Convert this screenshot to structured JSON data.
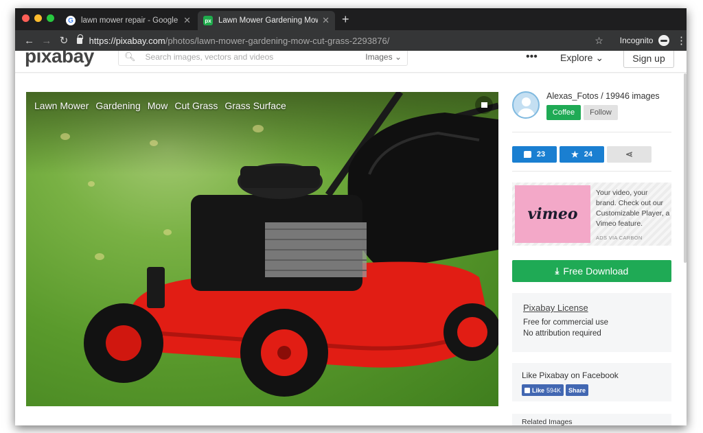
{
  "browser": {
    "tabs": [
      {
        "title": "lawn mower repair - Google Se",
        "favicon": "google-favicon",
        "active": false
      },
      {
        "title": "Lawn Mower Gardening Mow C",
        "favicon": "pixabay-favicon",
        "active": true
      }
    ],
    "url_host": "https://pixabay.com",
    "url_path": "/photos/lawn-mower-gardening-mow-cut-grass-2293876/",
    "incognito_label": "Incognito"
  },
  "site": {
    "logo": "pixabay",
    "search_placeholder": "Search images, vectors and videos",
    "search_scope": "Images",
    "explore_label": "Explore",
    "signup_label": "Sign up"
  },
  "photo": {
    "tags": [
      "Lawn Mower",
      "Gardening",
      "Mow",
      "Cut Grass",
      "Grass Surface"
    ]
  },
  "author": {
    "name_line": "Alexas_Fotos / 19946 images",
    "coffee_label": "Coffee",
    "follow_label": "Follow"
  },
  "actions": {
    "likes": "23",
    "favorites": "24"
  },
  "ad": {
    "brand": "vimeo",
    "text": "Your video, your brand. Check out our Customizable Player, a Vimeo feature.",
    "via": "ADS VIA CARBON"
  },
  "download_label": "Free Download",
  "license": {
    "title": "Pixabay License",
    "line1": "Free for commercial use",
    "line2": "No attribution required"
  },
  "facebook": {
    "title": "Like Pixabay on Facebook",
    "like_label": "Like",
    "like_count": "594K",
    "share_label": "Share"
  },
  "related_label": "Related Images",
  "colors": {
    "accent_green": "#1faa55",
    "accent_blue": "#1a7fd1",
    "facebook_blue": "#4267b2"
  }
}
